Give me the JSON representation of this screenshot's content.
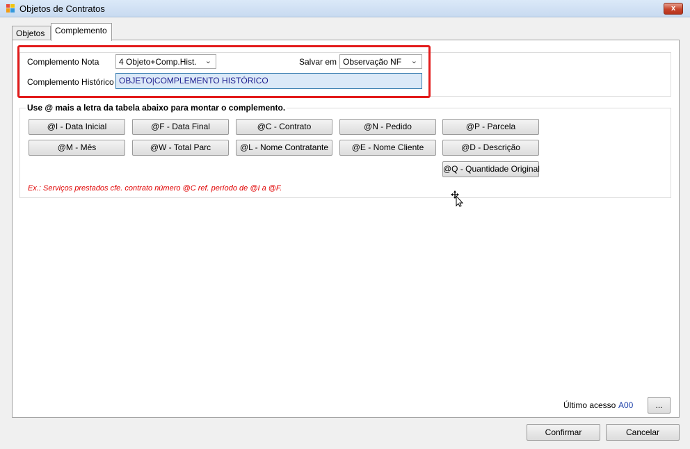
{
  "window": {
    "title": "Objetos de Contratos",
    "close_label": "x"
  },
  "tabs": [
    {
      "label": "Objetos"
    },
    {
      "label": "Complemento"
    }
  ],
  "form": {
    "complemento_nota_label": "Complemento Nota",
    "complemento_nota_value": "4 Objeto+Comp.Hist.",
    "salvar_em_label": "Salvar em",
    "salvar_em_value": "Observação NF",
    "complemento_historico_label": "Complemento Histórico",
    "complemento_historico_value": "OBJETO|COMPLEMENTO HISTÓRICO"
  },
  "reference": {
    "title": "Use @ mais a letra da tabela abaixo para montar o complemento.",
    "buttons": [
      {
        "label": "@I - Data Inicial"
      },
      {
        "label": "@F - Data Final"
      },
      {
        "label": "@C - Contrato"
      },
      {
        "label": "@N - Pedido"
      },
      {
        "label": "@P - Parcela"
      },
      {
        "label": "@M - Mês"
      },
      {
        "label": "@W - Total Parc"
      },
      {
        "label": "@L - Nome Contratante"
      },
      {
        "label": "@E - Nome Cliente"
      },
      {
        "label": "@D - Descrição"
      },
      {
        "label": "@Q - Quantidade Original"
      }
    ],
    "example": "Ex.: Serviços prestados cfe. contrato número @C ref. período de @I a @F."
  },
  "footer": {
    "last_access_label": "Último acesso",
    "last_access_value": "A00",
    "browse_label": "...",
    "confirm_label": "Confirmar",
    "cancel_label": "Cancelar"
  }
}
